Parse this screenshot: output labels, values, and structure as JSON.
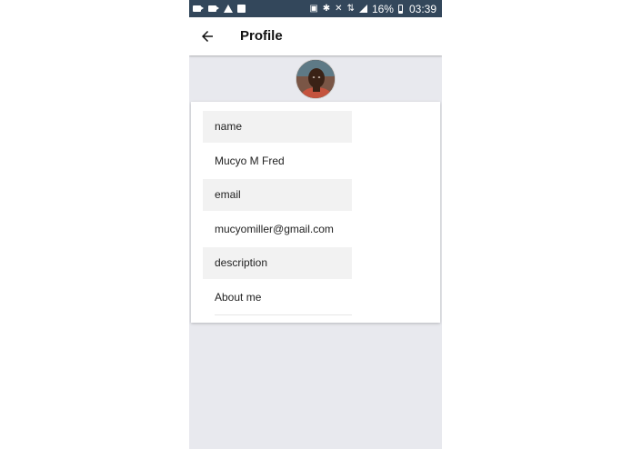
{
  "status_bar": {
    "battery_percent": "16%",
    "time": "03:39",
    "left_icons": [
      "video-camera-icon",
      "video-camera-icon",
      "warning-icon",
      "message-icon"
    ],
    "right_icons": [
      "nfc-icon",
      "bluetooth-icon",
      "mute-icon",
      "network-icon",
      "signal-icon",
      "battery-icon"
    ]
  },
  "appbar": {
    "title": "Profile",
    "back_icon": "arrow-left-icon"
  },
  "profile": {
    "fields": [
      {
        "label": "name",
        "value": "Mucyo M Fred"
      },
      {
        "label": "email",
        "value": "mucyomiller@gmail.com"
      },
      {
        "label": "description",
        "value": "About me"
      }
    ]
  },
  "colors": {
    "status_bar_bg": "#33475b",
    "page_bg": "#e8e9ee",
    "label_bg": "#f2f2f2",
    "card_bg": "#ffffff"
  }
}
